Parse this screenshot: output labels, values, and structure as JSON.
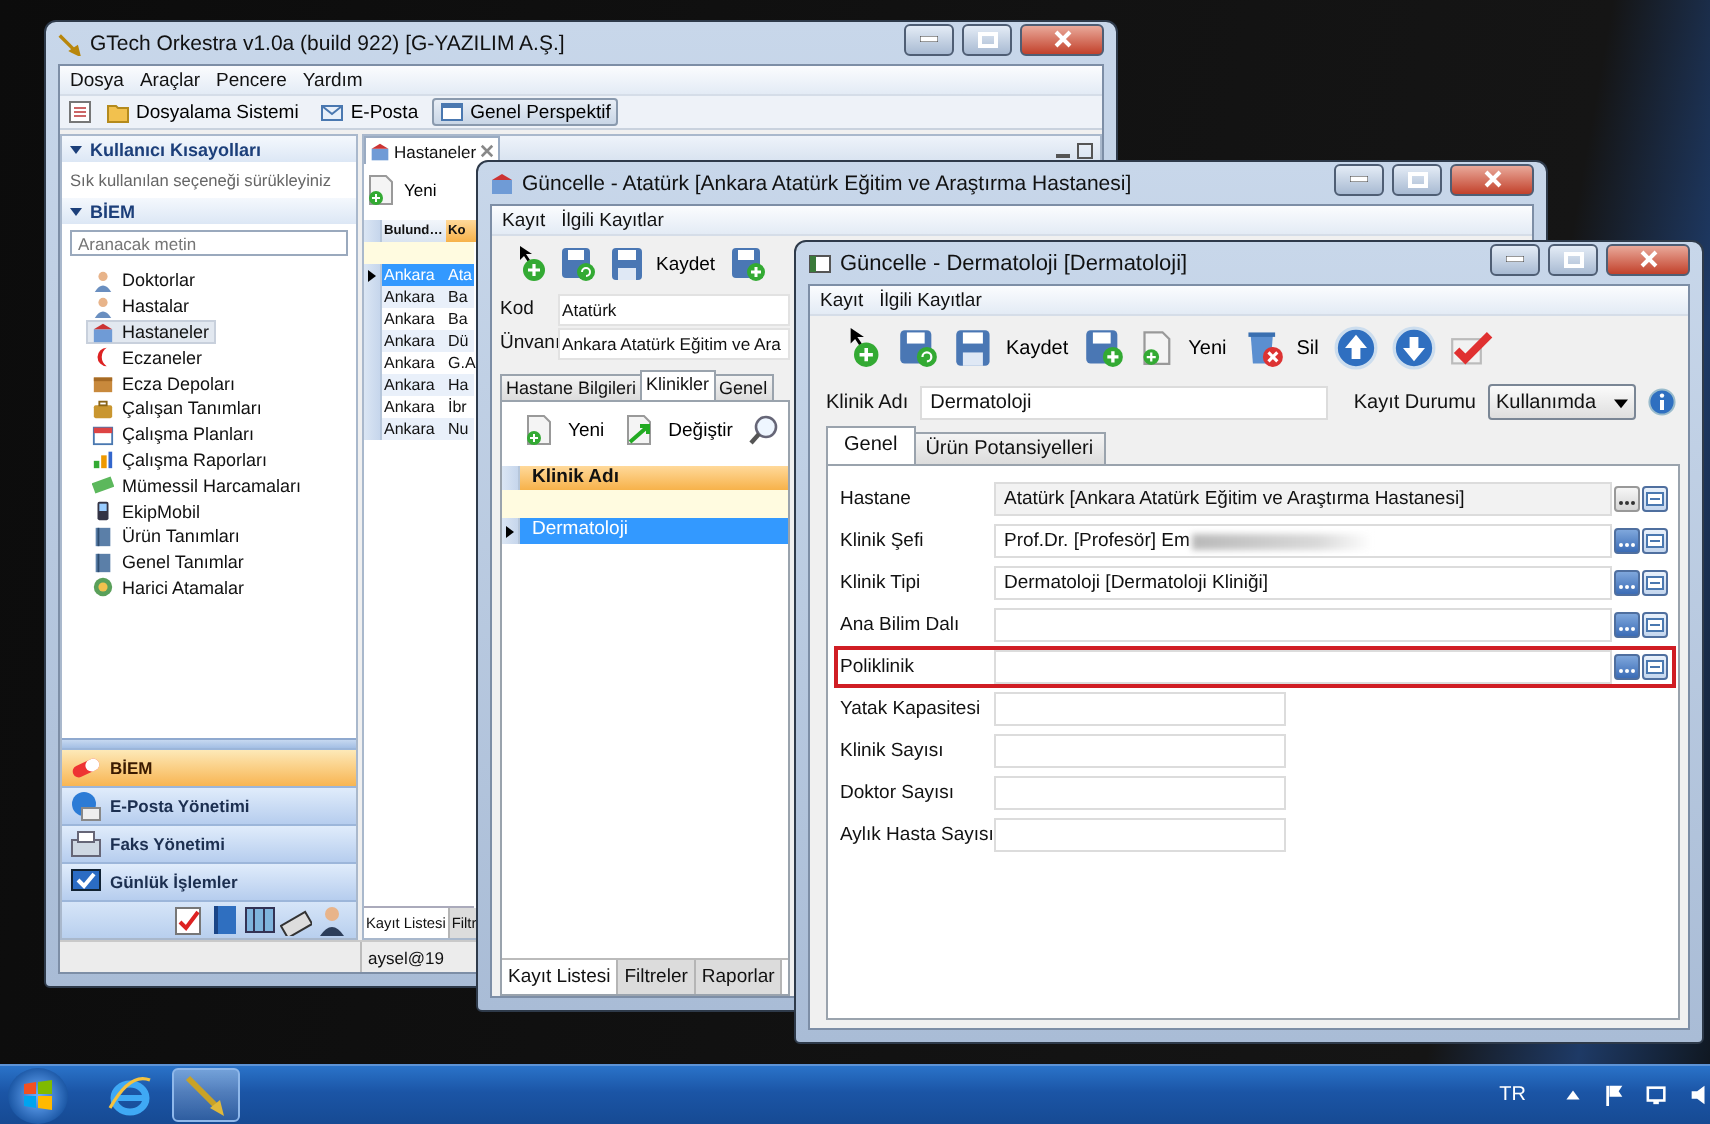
{
  "main_window": {
    "title": "GTech Orkestra v1.0a (build 922) [G-YAZILIM A.Ş.]",
    "menu": [
      "Dosya",
      "Araçlar",
      "Pencere",
      "Yardım"
    ],
    "toolbar": [
      {
        "label": "Dosyalama Sistemi",
        "selected": false
      },
      {
        "label": "E-Posta",
        "selected": false
      },
      {
        "label": "Genel Perspektif",
        "selected": true
      }
    ],
    "shortcuts": {
      "title": "Kullanıcı Kısayolları",
      "hint": "Sık kullanılan seçeneği sürükleyiniz"
    },
    "module": {
      "title": "BİEM",
      "search_placeholder": "Aranacak metin",
      "items": [
        {
          "label": "Doktorlar",
          "selected": false
        },
        {
          "label": "Hastalar",
          "selected": false
        },
        {
          "label": "Hastaneler",
          "selected": true
        },
        {
          "label": "Eczaneler",
          "selected": false
        },
        {
          "label": "Ecza Depoları",
          "selected": false
        },
        {
          "label": "Çalışan Tanımları",
          "selected": false
        },
        {
          "label": "Çalışma Planları",
          "selected": false
        },
        {
          "label": "Çalışma Raporları",
          "selected": false
        },
        {
          "label": "Mümessil Harcamaları",
          "selected": false
        },
        {
          "label": "EkipMobil",
          "selected": false
        },
        {
          "label": "Ürün Tanımları",
          "selected": false
        },
        {
          "label": "Genel Tanımlar",
          "selected": false
        },
        {
          "label": "Harici Atamalar",
          "selected": false
        }
      ]
    },
    "outlook": [
      {
        "label": "BİEM",
        "selected": true
      },
      {
        "label": "E-Posta Yönetimi",
        "selected": false
      },
      {
        "label": "Faks Yönetimi",
        "selected": false
      },
      {
        "label": "Günlük İşlemler",
        "selected": false
      }
    ],
    "document": {
      "tab": "Hastaneler",
      "new_label": "Yeni",
      "columns": [
        "Bulund…",
        "Ko"
      ],
      "rows": [
        {
          "cells": [
            "Ankara",
            "Ata"
          ],
          "selected": true
        },
        {
          "cells": [
            "Ankara",
            "Ba"
          ],
          "selected": false
        },
        {
          "cells": [
            "Ankara",
            "Ba"
          ],
          "selected": false
        },
        {
          "cells": [
            "Ankara",
            "Dü"
          ],
          "selected": false
        },
        {
          "cells": [
            "Ankara",
            "G.A"
          ],
          "selected": false
        },
        {
          "cells": [
            "Ankara",
            "Ha"
          ],
          "selected": false
        },
        {
          "cells": [
            "Ankara",
            "İbr"
          ],
          "selected": false
        },
        {
          "cells": [
            "Ankara",
            "Nu"
          ],
          "selected": false
        }
      ],
      "bottom_tabs": [
        {
          "label": "Kayıt Listesi",
          "selected": true
        },
        {
          "label": "Filtr",
          "selected": false
        }
      ]
    },
    "status": "aysel@19"
  },
  "hospital_window": {
    "title": "Güncelle - Atatürk [Ankara Atatürk Eğitim ve Araştırma Hastanesi]",
    "menu": [
      "Kayıt",
      "İlgili Kayıtlar"
    ],
    "save_label": "Kaydet",
    "fields": [
      {
        "label": "Kod",
        "value": "Atatürk"
      },
      {
        "label": "Ünvanı",
        "value": "Ankara Atatürk Eğitim ve Ara"
      }
    ],
    "tabs": [
      {
        "label": "Hastane Bilgileri",
        "selected": false
      },
      {
        "label": "Klinikler",
        "selected": true
      },
      {
        "label": "Genel",
        "selected": false
      }
    ],
    "new_label": "Yeni",
    "edit_label": "Değiştir",
    "column": "Klinik Adı",
    "rows": [
      {
        "cells": [
          "Dermatoloji"
        ],
        "selected": true
      }
    ],
    "bottom_tabs": [
      {
        "label": "Kayıt Listesi",
        "selected": true
      },
      {
        "label": "Filtreler",
        "selected": false
      },
      {
        "label": "Raporlar",
        "selected": false
      }
    ]
  },
  "clinic_window": {
    "title": "Güncelle - Dermatoloji [Dermatoloji]",
    "menu": [
      "Kayıt",
      "İlgili Kayıtlar"
    ],
    "save_label": "Kaydet",
    "new_label": "Yeni",
    "delete_label": "Sil",
    "name_label": "Klinik Adı",
    "name_value": "Dermatoloji",
    "status_label": "Kayıt Durumu",
    "status_value": "Kullanımda",
    "tabs": [
      {
        "label": "Genel",
        "selected": true
      },
      {
        "label": "Ürün Potansiyelleri",
        "selected": false
      }
    ],
    "fields": [
      {
        "kind": "lookup",
        "label": "Hastane",
        "value": "Atatürk [Ankara Atatürk Eğitim ve Araştırma Hastanesi]",
        "readonly": true,
        "redacted": false,
        "highlighted": false
      },
      {
        "kind": "lookup",
        "label": "Klinik Şefi",
        "value": "Prof.Dr. [Profesör] Em",
        "readonly": false,
        "redacted": true,
        "highlighted": false
      },
      {
        "kind": "lookup",
        "label": "Klinik Tipi",
        "value": "Dermatoloji [Dermatoloji Kliniği]",
        "readonly": false,
        "redacted": false,
        "highlighted": false
      },
      {
        "kind": "lookup",
        "label": "Ana Bilim Dalı",
        "readonly": false,
        "redacted": false,
        "highlighted": false
      },
      {
        "kind": "lookup",
        "label": "Poliklinik",
        "readonly": false,
        "redacted": false,
        "highlighted": true
      },
      {
        "kind": "number",
        "label": "Yatak Kapasitesi",
        "highlighted": false
      },
      {
        "kind": "number",
        "label": "Klinik Sayısı",
        "highlighted": false
      },
      {
        "kind": "number",
        "label": "Doktor Sayısı",
        "highlighted": false
      },
      {
        "kind": "number",
        "label": "Aylık Hasta Sayısı",
        "highlighted": false
      }
    ]
  },
  "taskbar": {
    "apps": [
      {
        "selected": false
      },
      {
        "selected": true
      }
    ],
    "language": "TR"
  }
}
